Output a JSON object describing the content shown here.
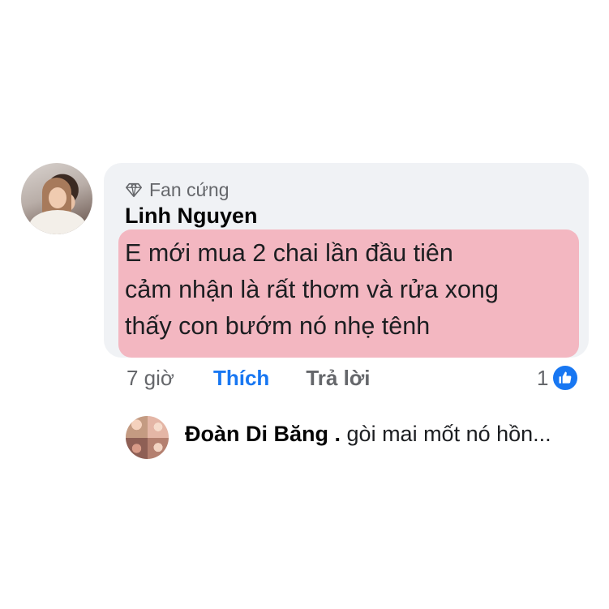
{
  "comment": {
    "badge": "Fan cứng",
    "author": "Linh Nguyen",
    "lines": [
      "E mới mua 2 chai lần đầu tiên",
      "cảm nhận là rất thơm và rửa xong",
      "thấy con bướm nó nhẹ tênh"
    ],
    "highlight_color": "#f3b7c1",
    "bubble_color": "#f0f2f5"
  },
  "actions": {
    "time": "7 giờ",
    "like_label": "Thích",
    "reply_label": "Trả lời",
    "reaction_count": "1",
    "accent_color": "#1877f2"
  },
  "reply_preview": {
    "author": "Đoàn Di Băng",
    "separator": " . ",
    "text": "gòi mai mốt nó hồn..."
  },
  "icons": {
    "badge": "diamond-icon",
    "reaction": "thumbs-up-icon"
  }
}
